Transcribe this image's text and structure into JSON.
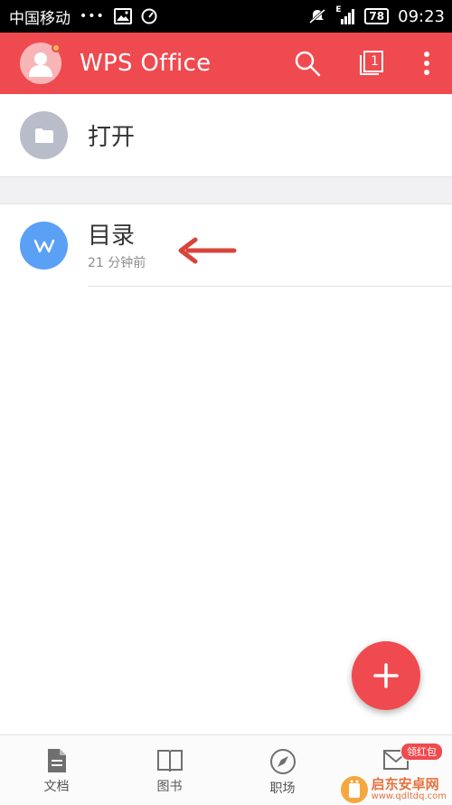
{
  "status_bar": {
    "carrier": "中国移动",
    "dots": "•••",
    "network": "E",
    "battery": "78",
    "time": "09:23"
  },
  "app_bar": {
    "title": "WPS Office",
    "tab_count": "1"
  },
  "open_row": {
    "label": "打开"
  },
  "recent_files": [
    {
      "name": "目录",
      "time": "21 分钟前",
      "icon_letter": "W"
    }
  ],
  "bottom_nav": {
    "items": [
      {
        "label": "文档",
        "icon": "document-icon"
      },
      {
        "label": "图书",
        "icon": "book-icon"
      },
      {
        "label": "职场",
        "icon": "compass-icon"
      },
      {
        "label": "",
        "icon": "mail-icon",
        "badge": "领红包"
      }
    ]
  },
  "watermark": {
    "name": "启东安卓网",
    "url": "www.qdltdq.com"
  },
  "colors": {
    "brand": "#ef4a4f",
    "file_icon": "#5aa0f5",
    "open_icon": "#b9bcc9"
  }
}
